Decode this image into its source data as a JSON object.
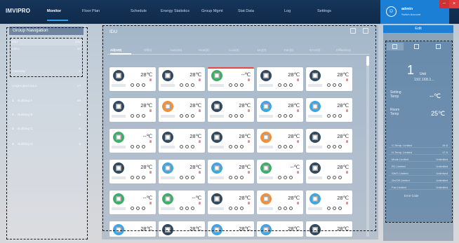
{
  "app": {
    "logo_main": "IMVI",
    "logo_pro": "PRO"
  },
  "nav": {
    "items": [
      {
        "label": "Monitor",
        "active": true
      },
      {
        "label": "Floor Plan"
      },
      {
        "label": "Schedule"
      },
      {
        "label": "Energy Statistics"
      },
      {
        "label": "Group Mgmt"
      },
      {
        "label": "Stat Data"
      },
      {
        "label": "Log"
      },
      {
        "label": "Settings"
      }
    ]
  },
  "user": {
    "name": "admin",
    "role": "Switch Account",
    "avatar_icon": "user-icon"
  },
  "window": {
    "minimize_glyph": "–",
    "close_glyph": "×"
  },
  "sidebar": {
    "title": "Group Navigation",
    "top_items": [
      {
        "label": "IDU",
        "count": "128"
      },
      {
        "label": "ODU",
        "count": "48"
      },
      {
        "label": "Gateway",
        "count": "1"
      }
    ],
    "ungrouped": {
      "label": "Ungrouped IDUs",
      "count": "17"
    },
    "buildings": [
      {
        "num": "1",
        "label": "Building A",
        "count": "48"
      },
      {
        "num": "2",
        "label": "Building B",
        "count": "9"
      },
      {
        "num": "3",
        "label": "Building C",
        "count": "6"
      },
      {
        "num": "4",
        "label": "Building D",
        "count": "8"
      }
    ]
  },
  "main": {
    "title": "IDU",
    "tabs": [
      {
        "label": "All(128)",
        "active": true
      },
      {
        "label": "Off(0)"
      },
      {
        "label": "Auto(46)"
      },
      {
        "label": "Heat(5)"
      },
      {
        "label": "Cool(8)"
      },
      {
        "label": "Dry(0)"
      },
      {
        "label": "Fan(5)"
      },
      {
        "label": "Error(0)"
      },
      {
        "label": "Offline(64)"
      }
    ],
    "cards": [
      [
        {
          "c": "#33495f",
          "t": "28℃"
        },
        {
          "c": "#33495f",
          "t": "28℃"
        },
        {
          "c": "#3fae6a",
          "t": "--℃",
          "alarm": true
        },
        {
          "c": "#33495f",
          "t": "28℃"
        },
        {
          "c": "#33495f",
          "t": "28℃"
        }
      ],
      [
        {
          "c": "#33495f",
          "t": "28℃"
        },
        {
          "c": "#f0903a",
          "t": "28℃"
        },
        {
          "c": "#33495f",
          "t": "28℃"
        },
        {
          "c": "#3fa6e0",
          "t": "28℃"
        },
        {
          "c": "#3fa6e0",
          "t": "28℃"
        }
      ],
      [
        {
          "c": "#3fae6a",
          "t": "--℃"
        },
        {
          "c": "#33495f",
          "t": "28℃"
        },
        {
          "c": "#33495f",
          "t": "28℃"
        },
        {
          "c": "#f0903a",
          "t": "28℃"
        },
        {
          "c": "#33495f",
          "t": "28℃"
        }
      ],
      [
        {
          "c": "#33495f",
          "t": "28℃"
        },
        {
          "c": "#3fa6e0",
          "t": "28℃"
        },
        {
          "c": "#3fa6e0",
          "t": "28℃"
        },
        {
          "c": "#3fae6a",
          "t": "--℃"
        },
        {
          "c": "#33495f",
          "t": "28℃"
        }
      ],
      [
        {
          "c": "#3fae6a",
          "t": "--℃"
        },
        {
          "c": "#3fae6a",
          "t": "--℃"
        },
        {
          "c": "#33495f",
          "t": "28℃"
        },
        {
          "c": "#f0903a",
          "t": "28℃"
        },
        {
          "c": "#3fa6e0",
          "t": "28℃"
        }
      ],
      [
        {
          "c": "#3fa6e0",
          "t": "28℃"
        },
        {
          "c": "#33495f",
          "t": "28℃"
        },
        {
          "c": "#3fa6e0",
          "t": "28℃"
        },
        {
          "c": "#3fa6e0",
          "t": "28℃"
        },
        {
          "c": "#33495f",
          "t": "28℃"
        }
      ]
    ]
  },
  "right": {
    "edit_label": "Edit",
    "unit_count": "1",
    "unit_label": "Unit",
    "unit_ip": "192.168.1...",
    "setting_temp_label": "Setting Temp",
    "setting_temp_value": "--℃",
    "room_temp_label": "Room Temp",
    "room_temp_value": "25℃",
    "info": [
      {
        "k": "C-Temp. Limited",
        "v": "26.5"
      },
      {
        "k": "H-Temp. Limited",
        "v": "17.5"
      },
      {
        "k": "Mode Limited",
        "v": "Unlimited"
      },
      {
        "k": "RC Limited",
        "v": "Unlimited"
      },
      {
        "k": "SWG Limited",
        "v": "Unlimited"
      },
      {
        "k": "On/Off Limited",
        "v": "Unlimited"
      },
      {
        "k": "Fan Limited",
        "v": "Unlimited"
      }
    ],
    "error_code_label": "Error Code"
  }
}
